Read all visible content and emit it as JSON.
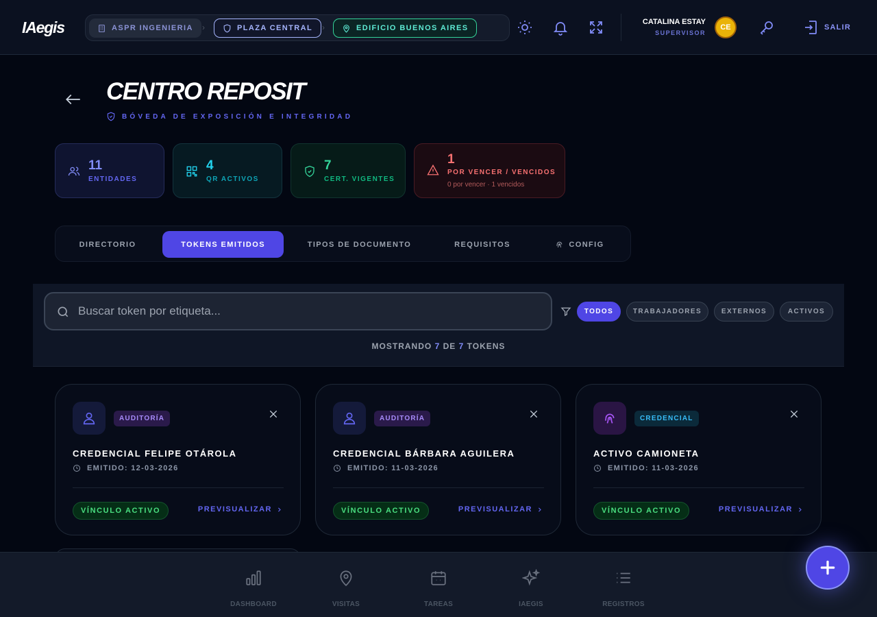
{
  "header": {
    "logo": "IAegis",
    "breadcrumbs": [
      {
        "label": "ASPR INGENIERIA",
        "icon": "building-icon"
      },
      {
        "label": "PLAZA CENTRAL",
        "icon": "shield-icon"
      },
      {
        "label": "EDIFICIO BUENOS AIRES",
        "icon": "map-pin-icon"
      }
    ],
    "breadcrumb_separator": "›",
    "user": {
      "name": "CATALINA ESTAY",
      "role": "SUPERVISOR",
      "initials": "CE"
    },
    "logout_label": "SALIR"
  },
  "page": {
    "title": "CENTRO REPOSIT",
    "subtitle": "BÓVEDA DE EXPOSICIÓN E INTEGRIDAD"
  },
  "stats": [
    {
      "value": "11",
      "label": "ENTIDADES",
      "icon": "users-icon",
      "color": "#818cf8"
    },
    {
      "value": "4",
      "label": "QR ACTIVOS",
      "icon": "qr-icon",
      "color": "#22d3ee"
    },
    {
      "value": "7",
      "label": "CERT. VIGENTES",
      "icon": "shield-check-icon",
      "color": "#34d399"
    },
    {
      "value": "1",
      "label": "POR VENCER / VENCIDOS",
      "sub": "0 por vencer · 1 vencidos",
      "icon": "alert-triangle-icon",
      "color": "#f87171"
    }
  ],
  "tabs": [
    {
      "label": "DIRECTORIO",
      "active": false
    },
    {
      "label": "TOKENS EMITIDOS",
      "active": true
    },
    {
      "label": "TIPOS DE DOCUMENTO",
      "active": false
    },
    {
      "label": "REQUISITOS",
      "active": false
    },
    {
      "label": "CONFIG",
      "active": false
    }
  ],
  "search": {
    "placeholder": "Buscar token por etiqueta...",
    "value": ""
  },
  "filters": [
    {
      "label": "TODOS",
      "active": true
    },
    {
      "label": "TRABAJADORES",
      "active": false
    },
    {
      "label": "EXTERNOS",
      "active": false
    },
    {
      "label": "ACTIVOS",
      "active": false
    }
  ],
  "showing": {
    "prefix": "MOSTRANDO",
    "count": "7",
    "mid": "DE",
    "total": "7",
    "suffix": "TOKENS"
  },
  "cards": [
    {
      "badge": "AUDITORÍA",
      "title": "CREDENCIAL FELIPE OTÁROLA",
      "date": "EMITIDO: 12-03-2026",
      "status": "VÍNCULO ACTIVO",
      "action": "PREVISUALIZAR"
    },
    {
      "badge": "AUDITORÍA",
      "title": "CREDENCIAL BÁRBARA AGUILERA",
      "date": "EMITIDO: 11-03-2026",
      "status": "VÍNCULO ACTIVO",
      "action": "PREVISUALIZAR"
    },
    {
      "badge": "CREDENCIAL",
      "title": "ACTIVO CAMIONETA",
      "date": "EMITIDO: 11-03-2026",
      "status": "VÍNCULO ACTIVO",
      "action": "PREVISUALIZAR"
    }
  ],
  "bottom_nav": [
    {
      "label": "DASHBOARD",
      "icon": "bar-chart-icon"
    },
    {
      "label": "VISITAS",
      "icon": "map-pin-icon"
    },
    {
      "label": "TAREAS",
      "icon": "calendar-icon"
    },
    {
      "label": "IAEGIS",
      "icon": "sparkles-icon"
    },
    {
      "label": "REGISTROS",
      "icon": "list-icon"
    }
  ],
  "colors": {
    "accent": "#4f46e5",
    "background": "#030712",
    "success": "#4ade80",
    "danger": "#f87171"
  }
}
